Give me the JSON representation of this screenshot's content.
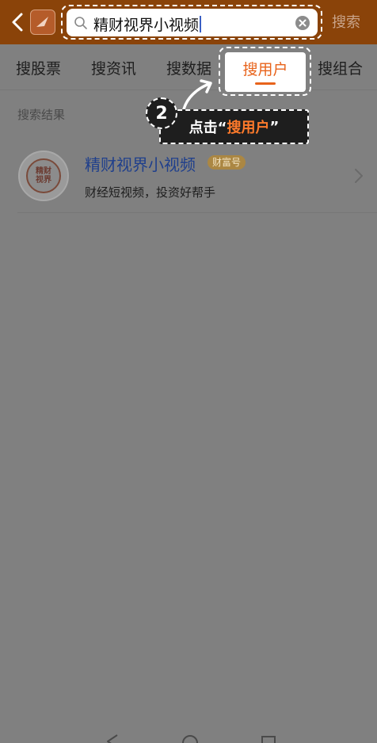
{
  "header": {
    "search_value": "精财视界小视频",
    "search_action": "搜索"
  },
  "tabs": [
    {
      "label": "搜股票"
    },
    {
      "label": "搜资讯"
    },
    {
      "label": "搜数据"
    },
    {
      "label": "搜用户",
      "active": true
    },
    {
      "label": "搜组合"
    }
  ],
  "annotation": {
    "step_number": "2",
    "text_before": "点击“",
    "text_highlight": "搜用户",
    "text_after": "”"
  },
  "results": {
    "section_title": "搜索结果",
    "items": [
      {
        "name": "精财视界小视频",
        "badge": "财富号",
        "description": "财经短视频，投资好帮手",
        "avatar_text_line1": "精财",
        "avatar_text_line2": "视界"
      }
    ]
  },
  "colors": {
    "header_bg": "#8a4309",
    "accent": "#e8631b",
    "link_blue": "#1f3f8c",
    "badge_gold": "#ab8743",
    "overlay_gray": "#808080"
  },
  "icons": [
    "back-icon",
    "app-logo-icon",
    "search-icon",
    "clear-icon",
    "arrow-icon",
    "chevron-right-icon",
    "nav-back-icon",
    "nav-home-icon",
    "nav-recent-icon"
  ]
}
